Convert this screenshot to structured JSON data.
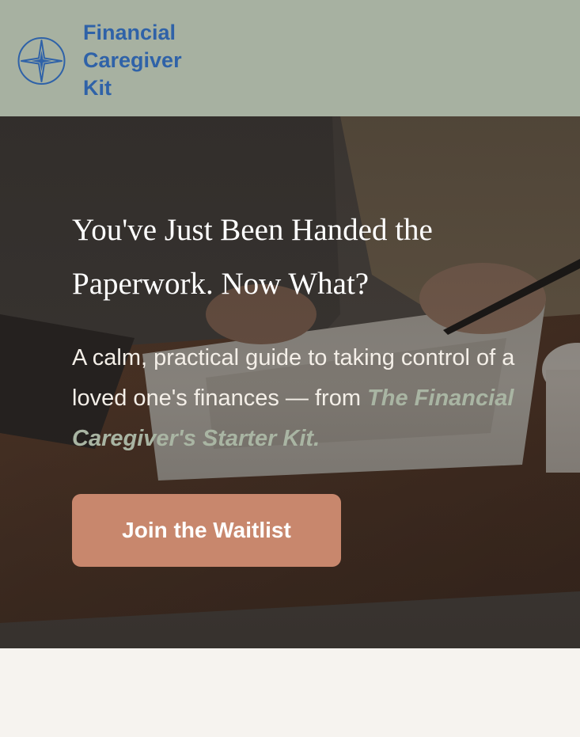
{
  "header": {
    "logo_icon": "compass-star-icon",
    "brand_lines": [
      "Financial",
      "Caregiver",
      "Kit"
    ]
  },
  "hero": {
    "title_line1": "You've Just Been Handed the",
    "title_line2": "Paperwork. Now What?",
    "subtitle_lead": "A calm, practical guide to taking control of a loved one's finances — from ",
    "subtitle_product": "The Financial Caregiver's Starter Kit.",
    "cta_label": "Join the Waitlist"
  },
  "colors": {
    "header_bg": "#a7b1a1",
    "brand_blue": "#2f62a8",
    "cta_bg": "#c8876d",
    "accent_sage": "#a9b5a3",
    "page_bg": "#f6f3ef"
  }
}
